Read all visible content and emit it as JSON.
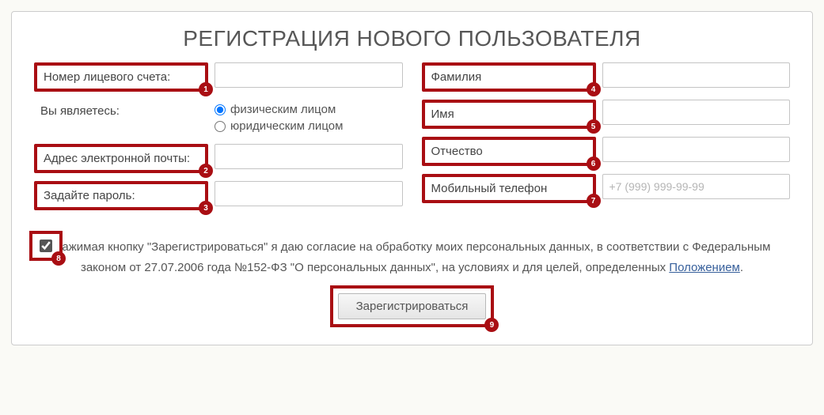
{
  "title": "РЕГИСТРАЦИЯ НОВОГО ПОЛЬЗОВАТЕЛЯ",
  "left": {
    "account_label": "Номер лицевого счета:",
    "you_are_label": "Вы являетесь:",
    "radio_individual": "физическим лицом",
    "radio_legal": "юридическим лицом",
    "email_label": "Адрес электронной почты:",
    "password_label": "Задайте пароль:"
  },
  "right": {
    "surname_label": "Фамилия",
    "name_label": "Имя",
    "patronymic_label": "Отчество",
    "phone_label": "Мобильный телефон",
    "phone_placeholder": "+7 (999) 999-99-99"
  },
  "consent": {
    "text_prefix": "Нажимая кнопку \"Зарегистрироваться\" я даю согласие на обработку моих персональных данных, в соответствии с Федеральным законом от 27.07.2006 года №152-ФЗ \"О персональных данных\", на условиях и для целей, определенных ",
    "link_text": "Положением",
    "suffix": "."
  },
  "submit_label": "Зарегистрироваться",
  "badges": {
    "b1": "1",
    "b2": "2",
    "b3": "3",
    "b4": "4",
    "b5": "5",
    "b6": "6",
    "b7": "7",
    "b8": "8",
    "b9": "9"
  }
}
